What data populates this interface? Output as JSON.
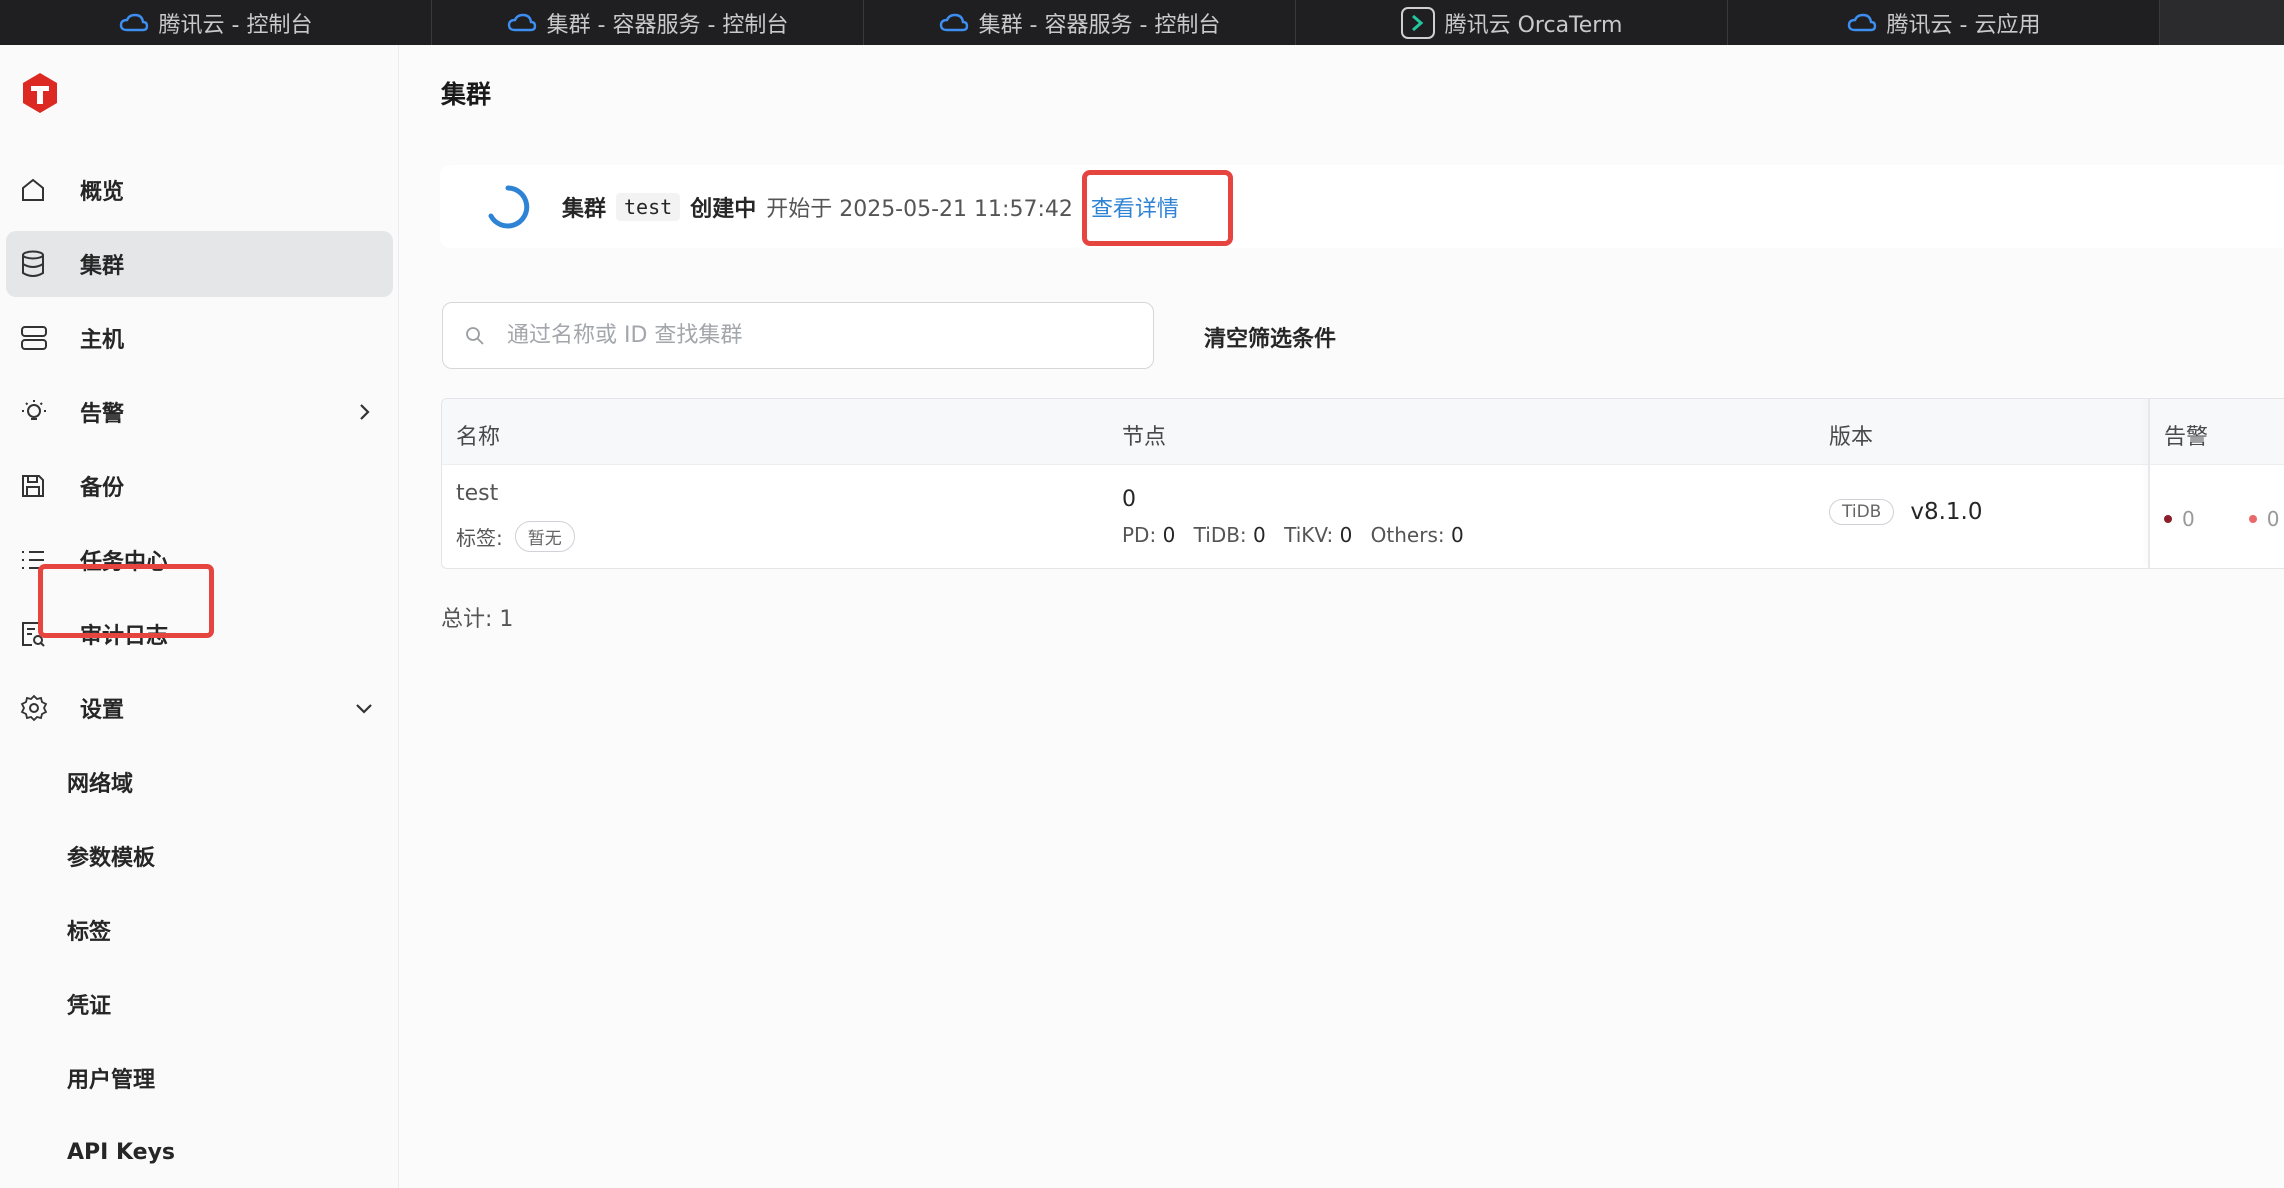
{
  "browser_tabs": [
    {
      "label": "腾讯云 - 控制台",
      "icon": "tencent-cloud-icon"
    },
    {
      "label": "集群 - 容器服务 - 控制台",
      "icon": "tencent-cloud-icon"
    },
    {
      "label": "集群 - 容器服务 - 控制台",
      "icon": "tencent-cloud-icon"
    },
    {
      "label": "腾讯云 OrcaTerm",
      "icon": "orcaterm-icon"
    },
    {
      "label": "腾讯云 - 云应用",
      "icon": "tencent-cloud-icon"
    }
  ],
  "sidebar": {
    "items": [
      {
        "label": "概览",
        "icon": "home-icon"
      },
      {
        "label": "集群",
        "icon": "database-icon",
        "active": true
      },
      {
        "label": "主机",
        "icon": "server-icon"
      },
      {
        "label": "告警",
        "icon": "lightbulb-icon"
      },
      {
        "label": "备份",
        "icon": "save-icon"
      },
      {
        "label": "任务中心",
        "icon": "list-icon"
      },
      {
        "label": "审计日志",
        "icon": "audit-icon"
      },
      {
        "label": "设置",
        "icon": "gear-icon"
      }
    ],
    "sub_items": [
      "网络域",
      "参数模板",
      "标签",
      "凭证",
      "用户管理",
      "API Keys"
    ]
  },
  "main": {
    "title": "集群",
    "notice": {
      "prefix": "集群",
      "cluster": "test",
      "status": "创建中",
      "started": "开始于 2025-05-21 11:57:42",
      "link": "查看详情"
    },
    "search": {
      "placeholder": "通过名称或 ID 查找集群"
    },
    "clear_filter": "清空筛选条件",
    "table": {
      "headers": [
        "名称",
        "节点",
        "版本",
        "告警"
      ],
      "row": {
        "name": "test",
        "tag_label": "标签:",
        "tag_value": "暂无",
        "node_count": "0",
        "pd_label": "PD:",
        "pd": "0",
        "tidb_label": "TiDB:",
        "tidb": "0",
        "tikv_label": "TiKV:",
        "tikv": "0",
        "others_label": "Others:",
        "others": "0",
        "engine": "TiDB",
        "version": "v8.1.0",
        "alert_critical": "0",
        "alert_warning": "0"
      }
    },
    "total": "总计: 1"
  },
  "colors": {
    "accent_link": "#2f83d4",
    "highlight": "#e5443f",
    "logo_red": "#dc2a23",
    "alert_critical": "#8b1e2b",
    "alert_warning": "#e8696b"
  }
}
